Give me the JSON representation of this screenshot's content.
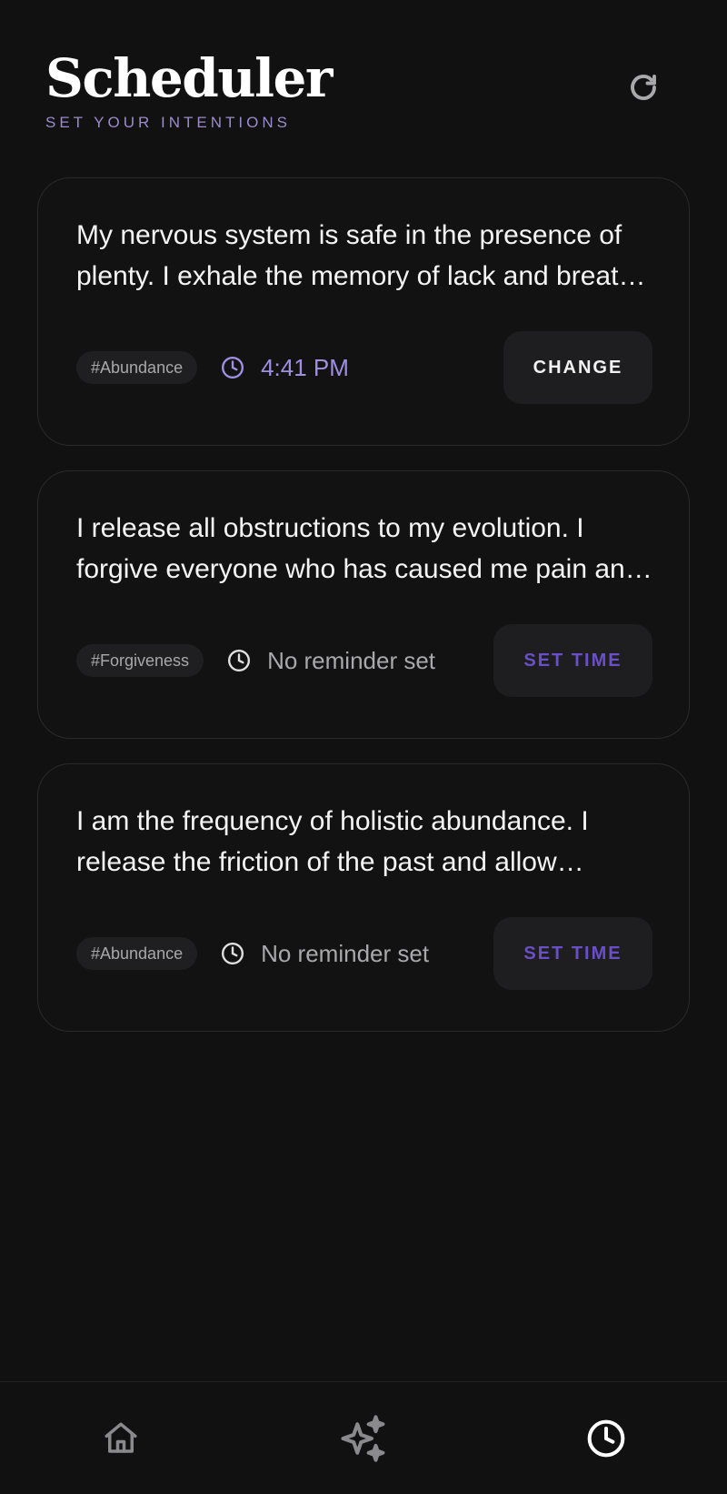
{
  "header": {
    "title": "Scheduler",
    "subtitle": "SET YOUR INTENTIONS",
    "refresh_icon": "refresh-icon"
  },
  "cards": [
    {
      "text": "My nervous system is safe in the presence of plenty. I exhale the memory of lack and breathe in the abundance that surrounds me.",
      "tag": "#Abundance",
      "time": "4:41 PM",
      "has_reminder": true,
      "button_label": "CHANGE"
    },
    {
      "text": "I release all obstructions to my evolution. I forgive everyone who has caused me pain and I set myself free.",
      "tag": "#Forgiveness",
      "time": "No reminder set",
      "has_reminder": false,
      "button_label": "SET TIME"
    },
    {
      "text": "I am the frequency of holistic abundance. I release the friction of the past and allow prosperity to flow.",
      "tag": "#Abundance",
      "time": "No reminder set",
      "has_reminder": false,
      "button_label": "SET TIME"
    }
  ],
  "nav": {
    "items": [
      {
        "icon": "home-icon",
        "active": false
      },
      {
        "icon": "sparkles-icon",
        "active": false
      },
      {
        "icon": "clock-icon",
        "active": true
      }
    ]
  },
  "colors": {
    "background": "#111112",
    "accent": "#a08fe0",
    "accent_dark": "#6a4fc8",
    "muted": "#a9a9ab"
  }
}
